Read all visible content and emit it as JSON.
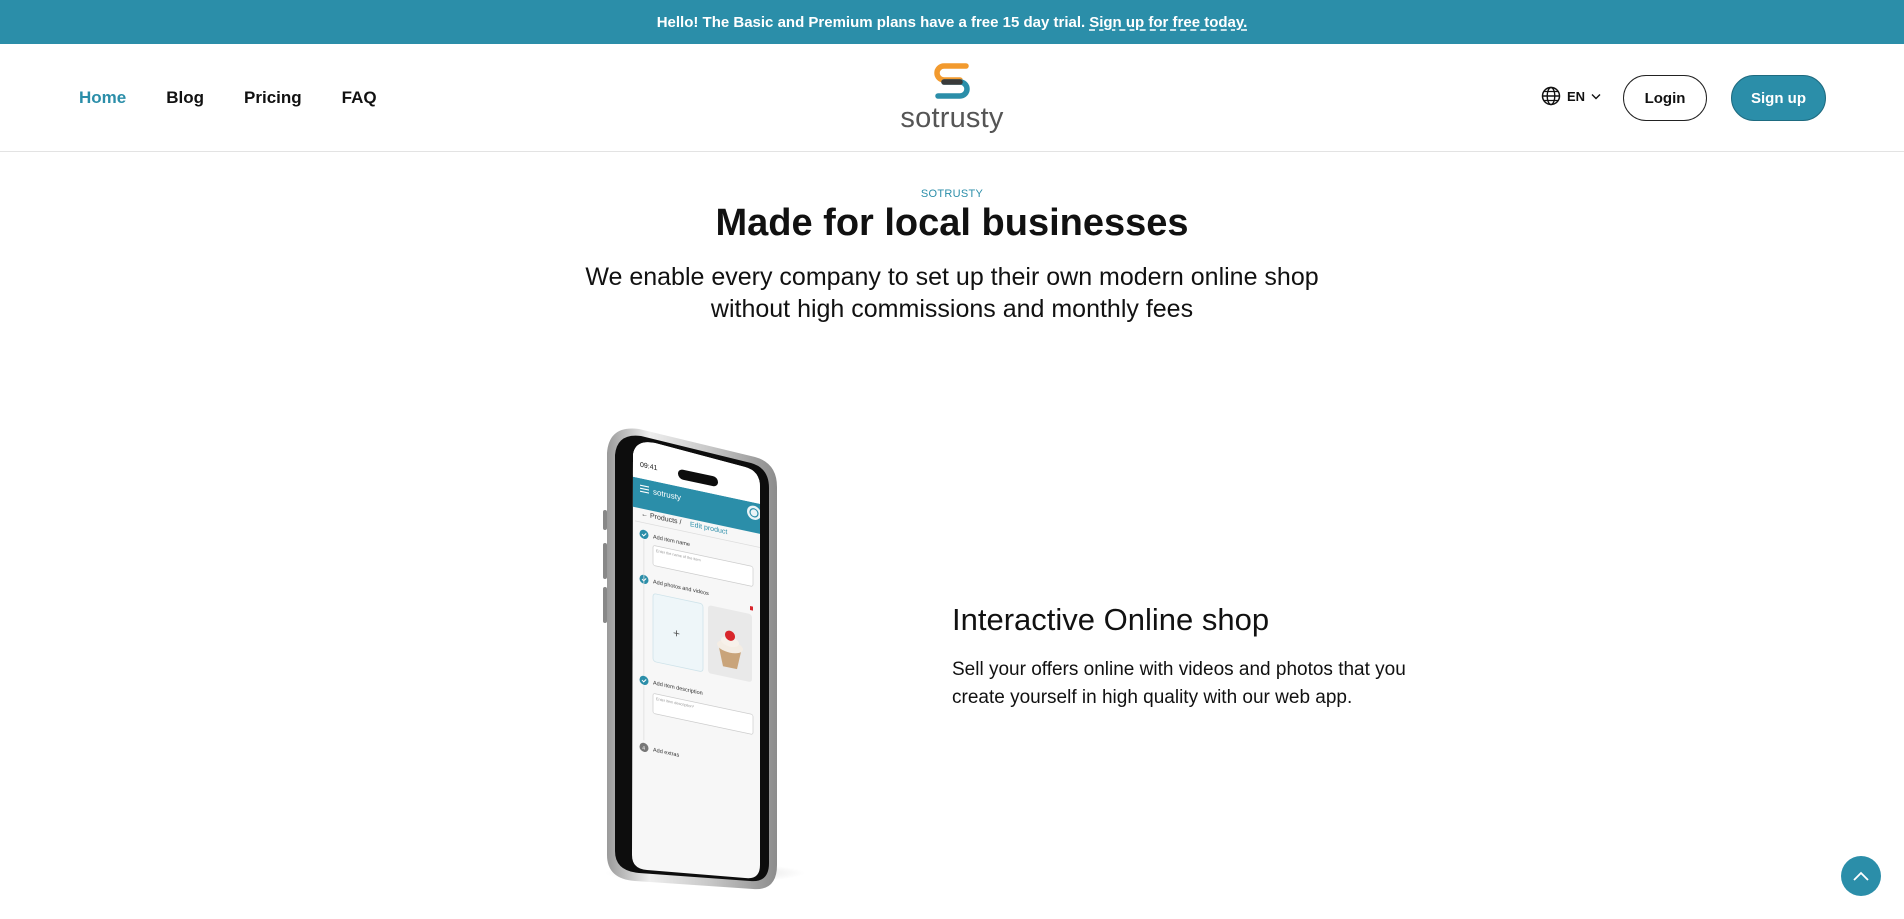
{
  "announcement": {
    "text": "Hello! The Basic and Premium plans have a free 15 day trial.",
    "link": "Sign up for free today."
  },
  "nav": {
    "items": [
      {
        "label": "Home",
        "active": true
      },
      {
        "label": "Blog"
      },
      {
        "label": "Pricing"
      },
      {
        "label": "FAQ"
      }
    ]
  },
  "logo": {
    "text": "sotrusty"
  },
  "header": {
    "language": "EN",
    "login_label": "Login",
    "signup_label": "Sign up"
  },
  "hero": {
    "eyebrow": "SOTRUSTY",
    "title": "Made for local businesses",
    "subtitle_line1": "We enable every company to set up their own modern online shop",
    "subtitle_line2": "without high commissions and monthly fees"
  },
  "feature": {
    "title": "Interactive Online shop",
    "text_line1": "Sell your offers online with videos and photos that you",
    "text_line2": "create yourself in high quality with our web app."
  },
  "phone": {
    "time": "09:41",
    "brand": "sotrusty",
    "breadcrumb_root": "Products /",
    "breadcrumb_current": "Edit product",
    "step1": "Add item name",
    "step1_placeholder": "Enter the name of the item",
    "step2": "Add photos and videos",
    "step3": "Add item description",
    "step3_placeholder": "Enter item description*",
    "step4": "Add extras",
    "step4_number": "4"
  },
  "colors": {
    "brand": "#2b8ea9",
    "logo_orange": "#f29a2e",
    "logo_blue": "#2b8ea9"
  }
}
